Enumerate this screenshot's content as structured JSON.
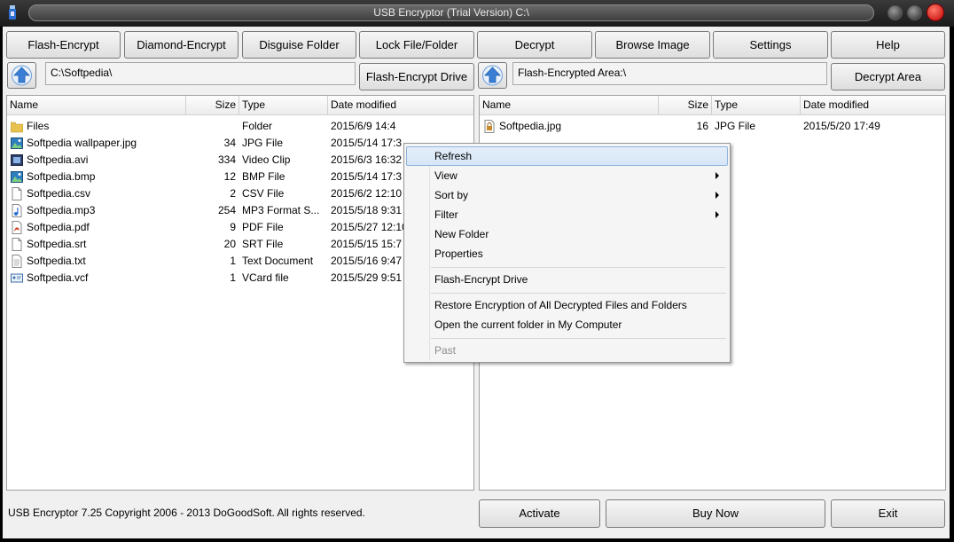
{
  "window": {
    "title": "USB Encryptor (Trial Version) C:\\"
  },
  "toolbar": [
    {
      "label": "Flash-Encrypt"
    },
    {
      "label": "Diamond-Encrypt"
    },
    {
      "label": "Disguise Folder"
    },
    {
      "label": "Lock File/Folder"
    },
    {
      "label": "Decrypt"
    },
    {
      "label": "Browse Image"
    },
    {
      "label": "Settings"
    },
    {
      "label": "Help"
    }
  ],
  "left": {
    "path": "C:\\Softpedia\\",
    "action_label": "Flash-Encrypt Drive",
    "columns": [
      "Name",
      "Size",
      "Type",
      "Date modified"
    ],
    "rows": [
      {
        "name": "Files",
        "size": "",
        "type": "Folder",
        "date": "2015/6/9 14:4",
        "icon": "folder-icon"
      },
      {
        "name": "Softpedia wallpaper.jpg",
        "size": "34",
        "type": "JPG File",
        "date": "2015/5/14 17:3",
        "icon": "image-icon"
      },
      {
        "name": "Softpedia.avi",
        "size": "334",
        "type": "Video Clip",
        "date": "2015/6/3 16:32",
        "icon": "video-icon"
      },
      {
        "name": "Softpedia.bmp",
        "size": "12",
        "type": "BMP File",
        "date": "2015/5/14 17:3",
        "icon": "image-icon"
      },
      {
        "name": "Softpedia.csv",
        "size": "2",
        "type": "CSV File",
        "date": "2015/6/2 12:10",
        "icon": "document-icon"
      },
      {
        "name": "Softpedia.mp3",
        "size": "254",
        "type": "MP3 Format S...",
        "date": "2015/5/18 9:31",
        "icon": "audio-icon"
      },
      {
        "name": "Softpedia.pdf",
        "size": "9",
        "type": "PDF File",
        "date": "2015/5/27 12:10",
        "icon": "pdf-icon"
      },
      {
        "name": "Softpedia.srt",
        "size": "20",
        "type": "SRT File",
        "date": "2015/5/15 15:7",
        "icon": "document-icon"
      },
      {
        "name": "Softpedia.txt",
        "size": "1",
        "type": "Text Document",
        "date": "2015/5/16 9:47",
        "icon": "text-icon"
      },
      {
        "name": "Softpedia.vcf",
        "size": "1",
        "type": "VCard file",
        "date": "2015/5/29 9:51",
        "icon": "vcard-icon"
      }
    ]
  },
  "right": {
    "path": "Flash-Encrypted Area:\\",
    "action_label": "Decrypt Area",
    "columns": [
      "Name",
      "Size",
      "Type",
      "Date modified"
    ],
    "rows": [
      {
        "name": "Softpedia.jpg",
        "size": "16",
        "type": "JPG File",
        "date": "2015/5/20 17:49",
        "icon": "encrypted-file-icon"
      }
    ]
  },
  "context_menu": {
    "items": [
      {
        "label": "Refresh",
        "highlighted": true
      },
      {
        "label": "View",
        "submenu": true
      },
      {
        "label": "Sort by",
        "submenu": true
      },
      {
        "label": "Filter",
        "submenu": true
      },
      {
        "label": "New Folder"
      },
      {
        "label": "Properties"
      },
      {
        "label": "Flash-Encrypt Drive"
      },
      {
        "label": "Restore Encryption of All Decrypted Files and Folders"
      },
      {
        "label": "Open the current folder in My Computer"
      },
      {
        "label": "Past",
        "disabled": true
      }
    ]
  },
  "footer": {
    "copyright": "USB Encryptor 7.25 Copyright 2006 - 2013 DoGoodSoft. All rights reserved.",
    "activate_label": "Activate",
    "buy_label": "Buy Now",
    "exit_label": "Exit"
  },
  "colors": {
    "highlight": "#d6e6f8",
    "close_button": "#c00000",
    "up_arrow": "#3a7fd5"
  }
}
